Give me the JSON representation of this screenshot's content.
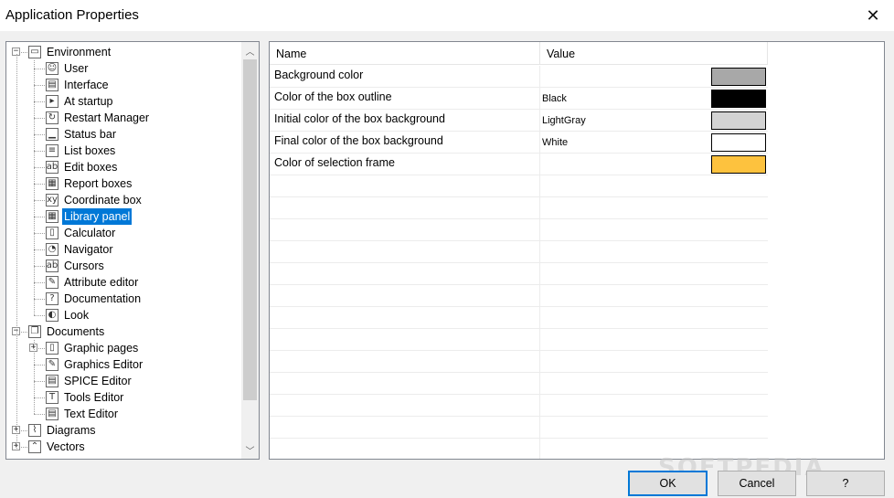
{
  "window": {
    "title": "Application Properties",
    "close_glyph": "✕"
  },
  "tree": {
    "items": [
      {
        "label": "Environment",
        "level": 0,
        "expander": "−",
        "icon": "window-icon",
        "glyph": "▭"
      },
      {
        "label": "User",
        "level": 1,
        "icon": "user-icon",
        "glyph": "☺"
      },
      {
        "label": "Interface",
        "level": 1,
        "icon": "interface-icon",
        "glyph": "▤"
      },
      {
        "label": "At startup",
        "level": 1,
        "icon": "startup-icon",
        "glyph": "▸"
      },
      {
        "label": "Restart Manager",
        "level": 1,
        "icon": "restart-icon",
        "glyph": "↻"
      },
      {
        "label": "Status bar",
        "level": 1,
        "icon": "statusbar-icon",
        "glyph": "▁"
      },
      {
        "label": "List boxes",
        "level": 1,
        "icon": "listbox-icon",
        "glyph": "≡"
      },
      {
        "label": "Edit boxes",
        "level": 1,
        "icon": "editbox-icon",
        "glyph": "ab"
      },
      {
        "label": "Report boxes",
        "level": 1,
        "icon": "reportbox-icon",
        "glyph": "▦"
      },
      {
        "label": "Coordinate box",
        "level": 1,
        "icon": "coordinate-icon",
        "glyph": "xy"
      },
      {
        "label": "Library panel",
        "level": 1,
        "icon": "grid-icon",
        "glyph": "▦",
        "selected": true
      },
      {
        "label": "Calculator",
        "level": 1,
        "icon": "calculator-icon",
        "glyph": "▯"
      },
      {
        "label": "Navigator",
        "level": 1,
        "icon": "navigator-icon",
        "glyph": "◔"
      },
      {
        "label": "Cursors",
        "level": 1,
        "icon": "cursors-icon",
        "glyph": "ab"
      },
      {
        "label": "Attribute editor",
        "level": 1,
        "icon": "attribute-icon",
        "glyph": "✎"
      },
      {
        "label": "Documentation",
        "level": 1,
        "icon": "help-icon",
        "glyph": "?"
      },
      {
        "label": "Look",
        "level": 1,
        "icon": "look-icon",
        "glyph": "◐"
      },
      {
        "label": "Documents",
        "level": 0,
        "expander": "−",
        "icon": "documents-icon",
        "glyph": "❐"
      },
      {
        "label": "Graphic pages",
        "level": 1,
        "expander": "+",
        "icon": "page-icon",
        "glyph": "▯"
      },
      {
        "label": "Graphics Editor",
        "level": 1,
        "icon": "graphics-editor-icon",
        "glyph": "✎"
      },
      {
        "label": "SPICE Editor",
        "level": 1,
        "icon": "spice-editor-icon",
        "glyph": "▤"
      },
      {
        "label": "Tools Editor",
        "level": 1,
        "icon": "tools-editor-icon",
        "glyph": "T"
      },
      {
        "label": "Text Editor",
        "level": 1,
        "icon": "text-editor-icon",
        "glyph": "▤"
      },
      {
        "label": "Diagrams",
        "level": 0,
        "expander": "+",
        "icon": "diagram-icon",
        "glyph": "⌇"
      },
      {
        "label": "Vectors",
        "level": 0,
        "expander": "+",
        "icon": "vectors-icon",
        "glyph": "⌃"
      }
    ]
  },
  "grid": {
    "headers": {
      "name": "Name",
      "value": "Value"
    },
    "rows": [
      {
        "name": "Background color",
        "value": "",
        "swatch": "#a8a8a8"
      },
      {
        "name": "Color of the box outline",
        "value": "Black",
        "swatch": "#000000"
      },
      {
        "name": "Initial color of the box background",
        "value": "LightGray",
        "swatch": "#d3d3d3"
      },
      {
        "name": "Final color of the box background",
        "value": "White",
        "swatch": "#ffffff"
      },
      {
        "name": "Color of selection frame",
        "value": "",
        "swatch": "#fdc23e"
      }
    ],
    "empty_rows": 13
  },
  "buttons": {
    "ok": "OK",
    "cancel": "Cancel",
    "help": "?"
  },
  "watermark": "SOFTPEDIA",
  "colors": {
    "selection": "#0078d7",
    "default_button_border": "#0078d7"
  }
}
